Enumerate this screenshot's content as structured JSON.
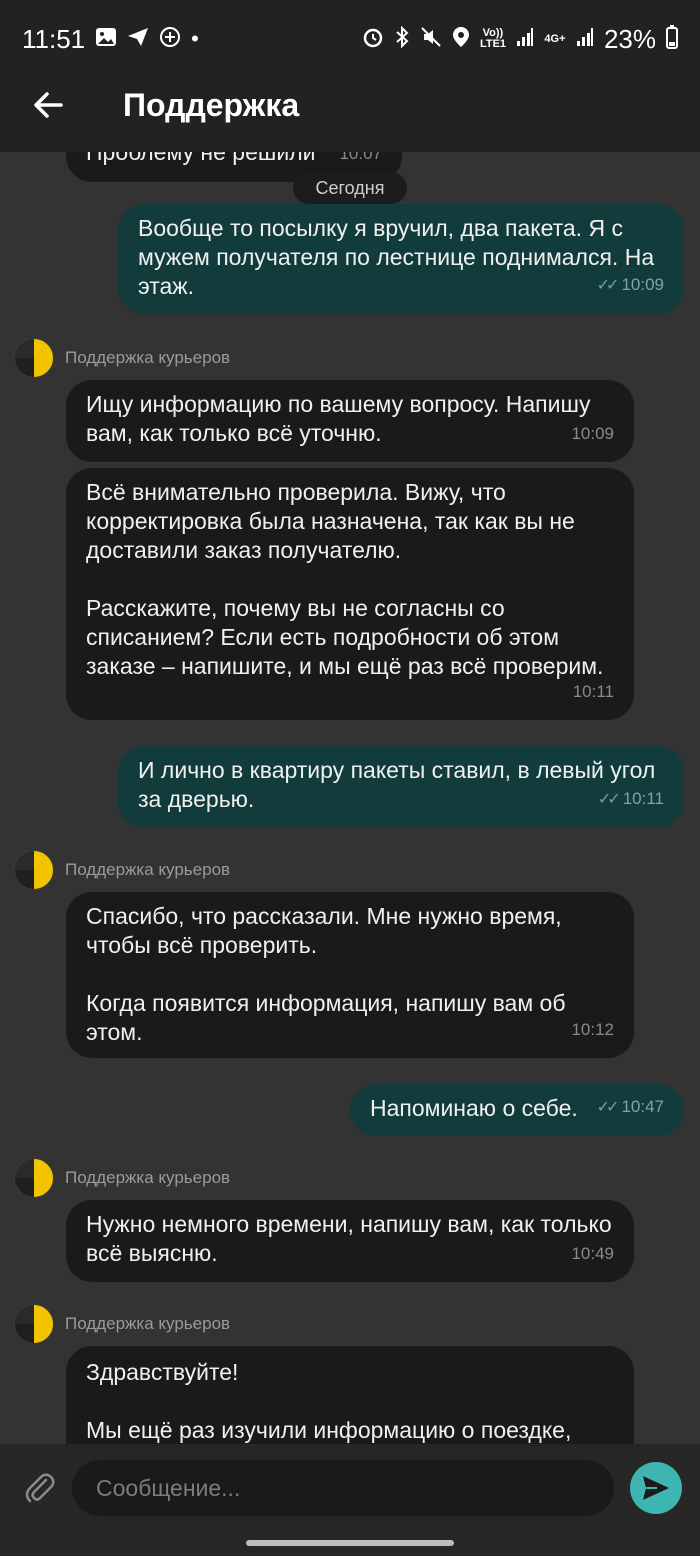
{
  "status_bar": {
    "time": "11:51",
    "volte": "Vo)) LTE1",
    "net": "4G+",
    "battery": "23%"
  },
  "header": {
    "title": "Поддержка",
    "back_icon": "arrow-left-icon"
  },
  "chat": {
    "partial_message": {
      "text": "Проблему не решили",
      "time": "10:07"
    },
    "date_chip": "Сегодня",
    "messages": [
      {
        "dir": "out",
        "text": "Вообще то посылку я вручил, два пакета. Я с мужем получателя по лестнице поднимался. На этаж.",
        "time": "10:09"
      },
      {
        "dir": "in",
        "sender": "Поддержка курьеров",
        "text": "Ищу информацию по вашему вопросу. Напишу вам, как только всё уточню.",
        "time": "10:09"
      },
      {
        "dir": "in",
        "text": "Всё внимательно проверила. Вижу, что корректировка была назначена, так как вы не доставили заказ получателю.\n\nРасскажите, почему вы не согласны со списанием? Если есть подробности об этом заказе – напишите, и мы ещё раз всё проверим.",
        "time": "10:11"
      },
      {
        "dir": "out",
        "text": "И лично в квартиру пакеты ставил, в левый угол за дверью.",
        "time": "10:11"
      },
      {
        "dir": "in",
        "sender": "Поддержка курьеров",
        "text": "Спасибо, что рассказали. Мне нужно время, чтобы всё проверить.\n\nКогда появится информация, напишу вам об этом.",
        "time": "10:12"
      },
      {
        "dir": "out",
        "text": "Напоминаю о себе.",
        "time": "10:47"
      },
      {
        "dir": "in",
        "sender": "Поддержка курьеров",
        "text": "Нужно немного времени, напишу вам, как только всё выясню.",
        "time": "10:49"
      },
      {
        "dir": "in",
        "sender": "Поддержка курьеров",
        "text": "Здравствуйте!\n\nМы ещё раз изучили информацию о поездке,",
        "time": ""
      }
    ]
  },
  "composer": {
    "placeholder": "Сообщение...",
    "attach_icon": "paperclip-icon",
    "send_icon": "send-icon"
  },
  "colors": {
    "incoming": "#1a1a1a",
    "outgoing": "#123c3c",
    "send_button": "#3fb5b2",
    "background": "#333333"
  }
}
